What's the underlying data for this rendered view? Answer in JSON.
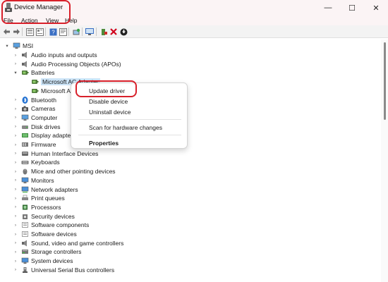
{
  "window": {
    "title": "Device Manager",
    "min_glyph": "—",
    "max_glyph": "☐",
    "close_glyph": "✕"
  },
  "menubar": {
    "items": [
      "File",
      "Action",
      "View",
      "Help"
    ]
  },
  "tree": {
    "root": "MSI",
    "items": [
      {
        "label": "Audio inputs and outputs",
        "icon": "speaker-icon"
      },
      {
        "label": "Audio Processing Objects (APOs)",
        "icon": "speaker-icon"
      },
      {
        "label": "Batteries",
        "icon": "battery-icon",
        "expanded": true
      },
      {
        "label": "Microsoft AC Adapter",
        "icon": "battery-icon",
        "child": true,
        "selected": true
      },
      {
        "label": "Microsoft ACPI-Compliant Control Method Battery",
        "icon": "battery-icon",
        "child": true
      },
      {
        "label": "Bluetooth",
        "icon": "bluetooth-icon"
      },
      {
        "label": "Cameras",
        "icon": "camera-icon"
      },
      {
        "label": "Computer",
        "icon": "computer-icon"
      },
      {
        "label": "Disk drives",
        "icon": "disk-icon"
      },
      {
        "label": "Display adapters",
        "icon": "display-icon"
      },
      {
        "label": "Firmware",
        "icon": "firmware-icon"
      },
      {
        "label": "Human Interface Devices",
        "icon": "hid-icon"
      },
      {
        "label": "Keyboards",
        "icon": "keyboard-icon"
      },
      {
        "label": "Mice and other pointing devices",
        "icon": "mouse-icon"
      },
      {
        "label": "Monitors",
        "icon": "monitor-icon"
      },
      {
        "label": "Network adapters",
        "icon": "network-icon"
      },
      {
        "label": "Print queues",
        "icon": "printer-icon"
      },
      {
        "label": "Processors",
        "icon": "processor-icon"
      },
      {
        "label": "Security devices",
        "icon": "security-icon"
      },
      {
        "label": "Software components",
        "icon": "software-icon"
      },
      {
        "label": "Software devices",
        "icon": "software-icon"
      },
      {
        "label": "Sound, video and game controllers",
        "icon": "speaker-icon"
      },
      {
        "label": "Storage controllers",
        "icon": "storage-icon"
      },
      {
        "label": "System devices",
        "icon": "system-icon"
      },
      {
        "label": "Universal Serial Bus controllers",
        "icon": "usb-icon"
      }
    ]
  },
  "context_menu": {
    "items": [
      {
        "label": "Update driver",
        "bold": false
      },
      {
        "label": "Disable device",
        "bold": false
      },
      {
        "label": "Uninstall device",
        "bold": false
      },
      {
        "label": "Scan for hardware changes",
        "bold": false
      },
      {
        "label": "Properties",
        "bold": true
      }
    ]
  },
  "colors": {
    "highlight_annotation": "#d8202a",
    "selection": "#cce4f7",
    "titlebar": "#fbf4f5"
  }
}
